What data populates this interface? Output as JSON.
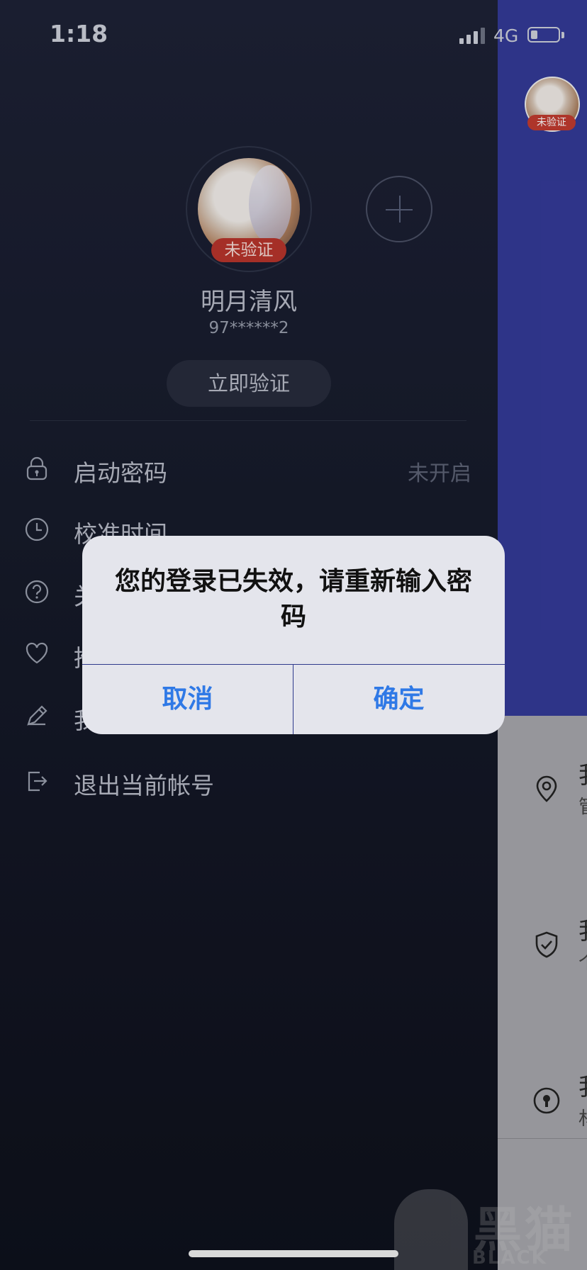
{
  "status": {
    "time": "1:18",
    "network": "4G",
    "battery_level": 0.25
  },
  "background_app": {
    "badge": "未验证",
    "rows": [
      {
        "icon": "location-pin-icon",
        "title": "我",
        "sub": "管"
      },
      {
        "icon": "shield-check-icon",
        "title": "我",
        "sub": "个"
      },
      {
        "icon": "keyhole-icon",
        "title": "我",
        "sub": "材"
      }
    ]
  },
  "profile": {
    "badge": "未验证",
    "name": "明月清风",
    "id": "97******2",
    "verify_button": "立即验证"
  },
  "menu": [
    {
      "icon": "lock-icon",
      "label": "启动密码",
      "value": "未开启"
    },
    {
      "icon": "clock-icon",
      "label": "校准时间",
      "value": ""
    },
    {
      "icon": "question-icon",
      "label": "关",
      "value": ""
    },
    {
      "icon": "heart-icon",
      "label": "推",
      "value": ""
    },
    {
      "icon": "pencil-icon",
      "label": "我",
      "value": ""
    },
    {
      "icon": "logout-icon",
      "label": "退出当前帐号",
      "value": ""
    }
  ],
  "alert": {
    "message": "您的登录已失效，请重新输入密码",
    "cancel": "取消",
    "confirm": "确定"
  },
  "watermark": {
    "big": "黑猫",
    "small": "BLACK CAT"
  }
}
